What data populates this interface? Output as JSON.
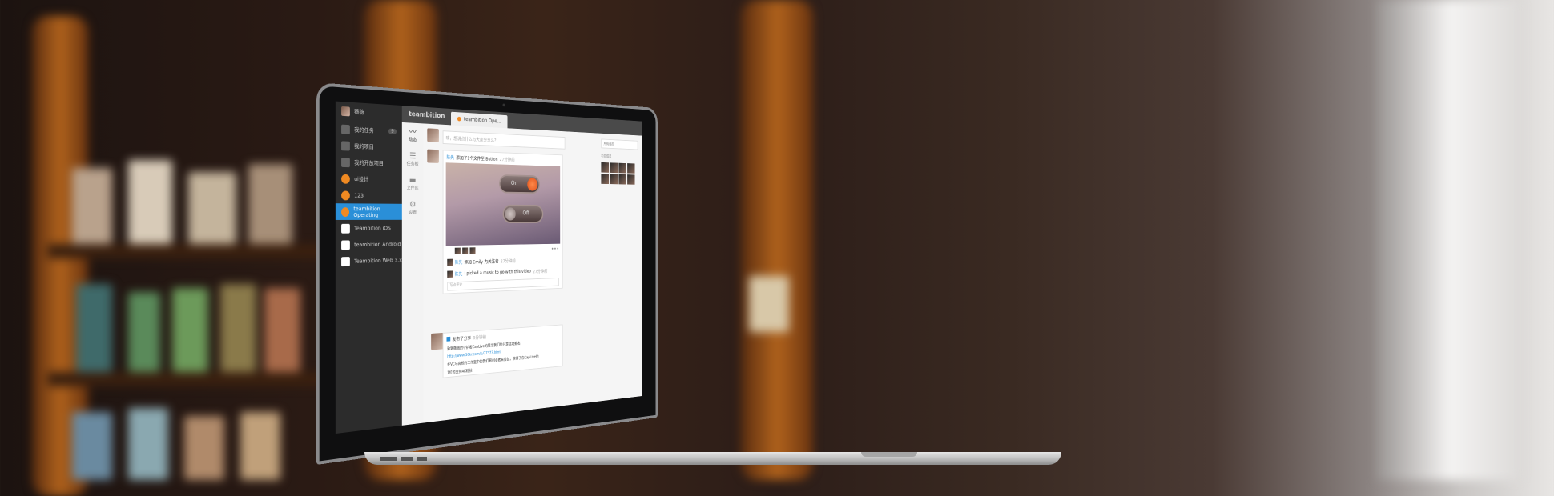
{
  "sidebar": {
    "user": "薇薇",
    "items": [
      {
        "label": "我的任务",
        "badge": "9",
        "icon": "task-icon"
      },
      {
        "label": "我的项目",
        "icon": "folder-icon"
      },
      {
        "label": "我的开放项目",
        "icon": "folder-icon"
      },
      {
        "label": "ui设计",
        "icon": "project-icon"
      },
      {
        "label": "123",
        "icon": "project-icon"
      },
      {
        "label": "teambition Operating",
        "icon": "project-icon",
        "active": true
      },
      {
        "label": "Teambition iOS",
        "icon": "project-icon"
      },
      {
        "label": "teambition Android",
        "icon": "project-icon"
      },
      {
        "label": "Teambition Web 3.x",
        "icon": "project-icon"
      }
    ]
  },
  "topbar": {
    "brand": "teambition",
    "tab": "teambition Ope..."
  },
  "nav": [
    {
      "label": "动态",
      "glyph": "activity-icon"
    },
    {
      "label": "任务板",
      "glyph": "list-icon"
    },
    {
      "label": "文件库",
      "glyph": "folder-icon"
    },
    {
      "label": "设置",
      "glyph": "gear-icon"
    }
  ],
  "main": {
    "compose_placeholder": "嗨，想说点什么与大家分享么？",
    "post1": {
      "author": "陈先",
      "action": "添加了1个文件至 Button",
      "time": "27分钟前"
    },
    "toggle": {
      "on": "On",
      "off": "Off"
    },
    "comments": [
      {
        "author": "陈先",
        "text": "添加 Emily 为关注者",
        "time": "27分钟前"
      },
      {
        "author": "陈先",
        "text": "I picked a music to go with this video",
        "time": "27分钟前"
      }
    ],
    "comment_placeholder": "写点评论",
    "post2": {
      "action": "发布了分享",
      "time": "8分钟前",
      "lines": [
        "致致敬她的守护者CapLive的展示我们的分享活动报名",
        "http://www.36kr.com/p/77373.html",
        "在VC与高校的工作室中的我们跟创业者来尝试，获得了在CapLive的",
        "1位的支持AK粉丝"
      ]
    }
  },
  "aside": {
    "filter": "所有动态",
    "members_label": "项目成员"
  },
  "ports": [
    "usb-port",
    "hdmi-port",
    "thunderbolt-port"
  ]
}
